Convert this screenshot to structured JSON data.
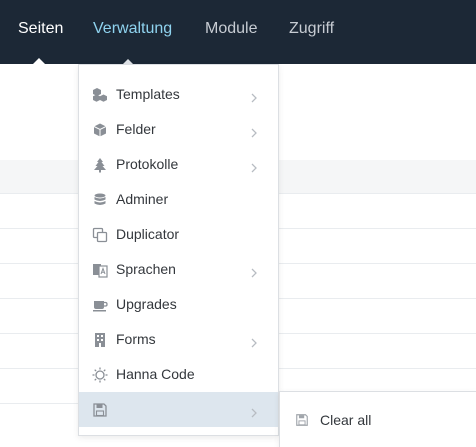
{
  "nav": {
    "items": [
      {
        "label": "Seiten",
        "state": "active"
      },
      {
        "label": "Verwaltung",
        "state": "hover"
      },
      {
        "label": "Module",
        "state": "normal"
      },
      {
        "label": "Zugriff",
        "state": "normal"
      }
    ]
  },
  "dropdown": {
    "items": [
      {
        "label": "Templates",
        "icon": "cubes-icon",
        "has_submenu": true
      },
      {
        "label": "Felder",
        "icon": "cube-icon",
        "has_submenu": true
      },
      {
        "label": "Protokolle",
        "icon": "tree-icon",
        "has_submenu": true
      },
      {
        "label": "Adminer",
        "icon": "database-icon",
        "has_submenu": false
      },
      {
        "label": "Duplicator",
        "icon": "clone-icon",
        "has_submenu": false
      },
      {
        "label": "Sprachen",
        "icon": "language-icon",
        "has_submenu": true
      },
      {
        "label": "Upgrades",
        "icon": "coffee-icon",
        "has_submenu": false
      },
      {
        "label": "Forms",
        "icon": "building-icon",
        "has_submenu": true
      },
      {
        "label": "Hanna Code",
        "icon": "sun-icon",
        "has_submenu": false
      },
      {
        "label": "",
        "icon": "floppy-disk-icon",
        "has_submenu": true,
        "selected": true
      }
    ]
  },
  "flyout": {
    "items": [
      {
        "label": "Clear all",
        "icon": "floppy-disk-icon"
      }
    ]
  },
  "colors": {
    "topbar_bg": "#1c2836",
    "nav_active": "#ffffff",
    "nav_hover": "#8fd3ef",
    "nav_normal": "#c7ccd3",
    "selected_bg": "#dde6ee",
    "text": "#33373c",
    "icon": "#8a8f96"
  }
}
